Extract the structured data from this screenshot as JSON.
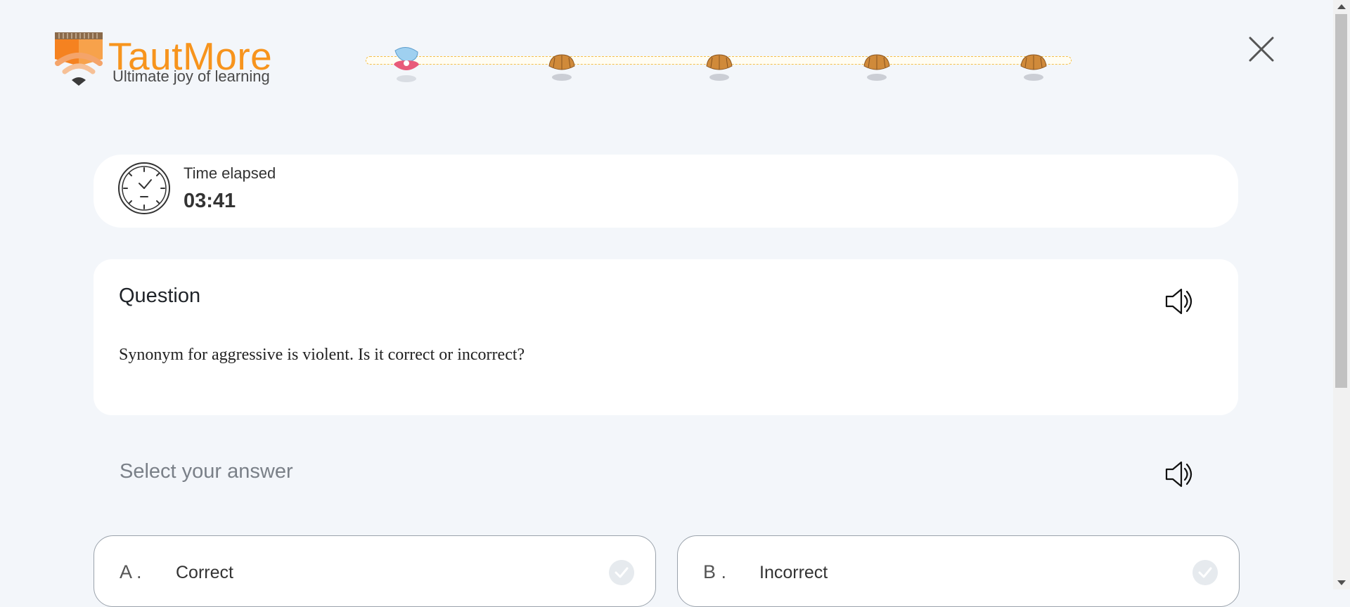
{
  "brand": {
    "name": "TautMore",
    "tagline": "Ultimate joy of learning",
    "logo_icon": "wifi-book-logo-icon",
    "accent_color": "#f7941d"
  },
  "progress": {
    "steps": [
      {
        "icon": "open-pearl-shell-icon",
        "state": "current"
      },
      {
        "icon": "closed-shell-icon",
        "state": "pending"
      },
      {
        "icon": "closed-shell-icon",
        "state": "pending"
      },
      {
        "icon": "closed-shell-icon",
        "state": "pending"
      },
      {
        "icon": "closed-shell-icon",
        "state": "pending"
      }
    ]
  },
  "header": {
    "close_icon": "close-icon"
  },
  "timer": {
    "label": "Time elapsed",
    "value": "03:41",
    "icon": "clock-icon"
  },
  "question": {
    "title": "Question",
    "text": "Synonym for aggressive is violent. Is it correct or incorrect?",
    "audio_icon": "speaker-icon"
  },
  "answers": {
    "prompt": "Select your answer",
    "audio_icon": "speaker-icon",
    "options": [
      {
        "letter": "A .",
        "text": "Correct",
        "icon": "check-circle-icon"
      },
      {
        "letter": "B .",
        "text": "Incorrect",
        "icon": "check-circle-icon"
      }
    ]
  }
}
